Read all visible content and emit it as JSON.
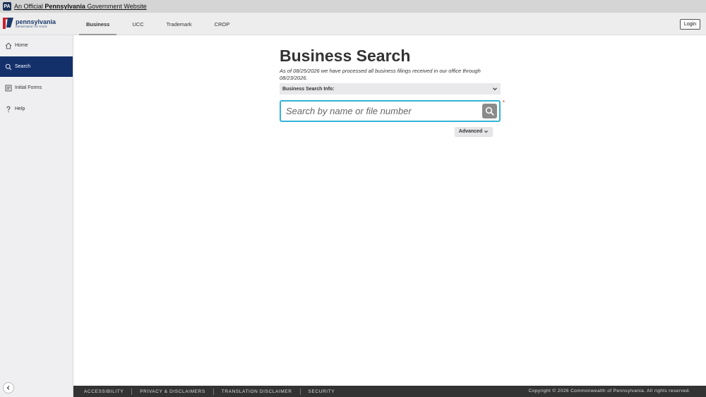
{
  "banner": {
    "badge": "PA",
    "prefix": "An Official ",
    "state": "Pennsylvania",
    "suffix": " Government Website"
  },
  "header": {
    "logo_name": "pennsylvania",
    "logo_sub": "DEPARTMENT OF STATE",
    "tabs": [
      {
        "label": "Business",
        "active": true
      },
      {
        "label": "UCC"
      },
      {
        "label": "Trademark"
      },
      {
        "label": "CROP"
      }
    ],
    "login_label": "Login"
  },
  "sidebar": {
    "items": [
      {
        "label": "Home",
        "icon": "home-icon"
      },
      {
        "label": "Search",
        "icon": "search-icon",
        "active": true
      },
      {
        "label": "Initial Forms",
        "icon": "forms-icon"
      },
      {
        "label": "Help",
        "icon": "help-icon"
      }
    ],
    "collapse_icon": "chevron-left-icon"
  },
  "main": {
    "title": "Business Search",
    "subtitle": "As of 08/25/2026 we have processed all business filings received in our office through 08/23/2026.",
    "info_label": "Business Search Info:",
    "search_placeholder": "Search by name or file number",
    "search_value": "",
    "required_mark": "*",
    "advanced_label": "Advanced"
  },
  "footer": {
    "links": [
      "ACCESSIBILITY",
      "PRIVACY & DISCLAIMERS",
      "TRANSLATION DISCLAIMER",
      "SECURITY"
    ],
    "copyright": "Copyright © 2026 Commonwealth of Pennsylvania. All rights reserved."
  },
  "colors": {
    "nav_active": "#13306b",
    "search_border": "#35b3d7",
    "footer_bg": "#333333",
    "required": "#dd2222"
  }
}
